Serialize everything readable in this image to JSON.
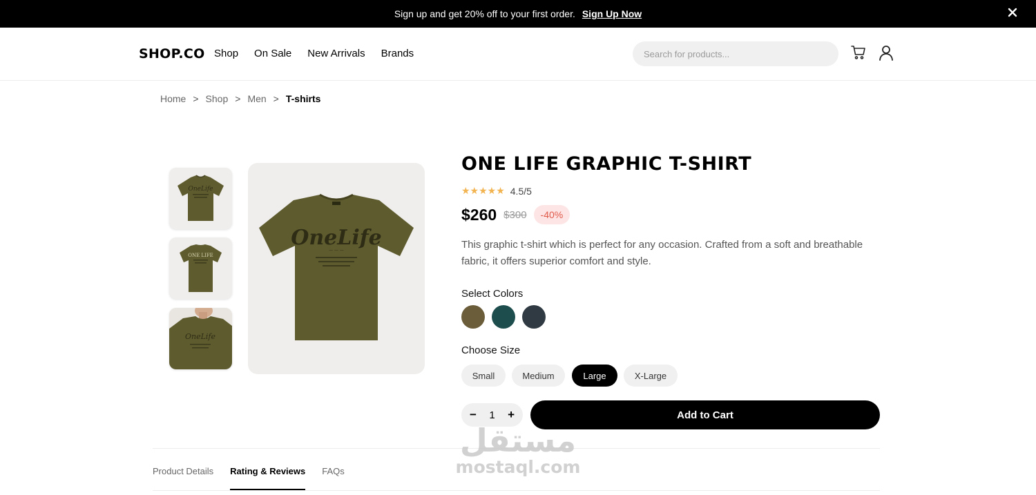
{
  "promo": {
    "text": "Sign up and get 20% off to your first order.",
    "link": "Sign Up Now"
  },
  "nav": {
    "logo": "SHOP.CO",
    "links": [
      "Shop",
      "On Sale",
      "New Arrivals",
      "Brands"
    ],
    "search_placeholder": "Search for products..."
  },
  "breadcrumb": {
    "items": [
      "Home",
      "Shop",
      "Men"
    ],
    "separator": ">",
    "current": "T-shirts"
  },
  "product": {
    "title": "ONE LIFE GRAPHIC T-SHIRT",
    "stars": "★★★★★",
    "rating": "4.5/5",
    "price": "$260",
    "old_price": "$300",
    "discount": "-40%",
    "description": "This graphic t-shirt which is perfect for any occasion. Crafted from a soft and breathable fabric, it offers superior comfort and style.",
    "colors_label": "Select Colors",
    "colors": [
      "#6b5d3a",
      "#1e4d4d",
      "#303a42"
    ],
    "size_label": "Choose Size",
    "sizes": [
      "Small",
      "Medium",
      "Large",
      "X-Large"
    ],
    "selected_size": "Large",
    "quantity": "1",
    "qty_minus": "−",
    "qty_plus": "+",
    "add_to_cart": "Add to Cart"
  },
  "tabs": [
    "Product Details",
    "Rating & Reviews",
    "FAQs"
  ],
  "active_tab": "Rating & Reviews",
  "watermark": {
    "arabic": "مستقل",
    "latin": "mostaql.com"
  }
}
